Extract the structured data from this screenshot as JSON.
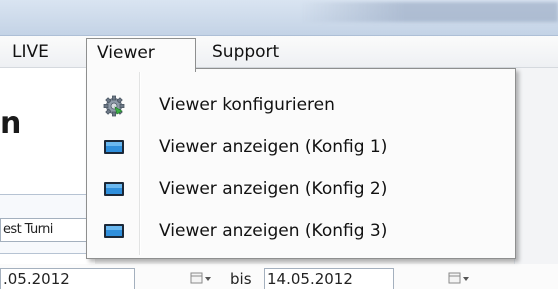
{
  "menubar": {
    "items": [
      {
        "label": "LIVE"
      },
      {
        "label": "Viewer"
      },
      {
        "label": "Support"
      }
    ]
  },
  "page": {
    "heading_fragment": "n",
    "field_fragment": "est Turni",
    "date_from": ".05.2012",
    "bis_label": "bis",
    "date_to": "14.05.2012"
  },
  "viewer_menu": {
    "items": [
      {
        "label": "Viewer konfigurieren",
        "icon": "gear-icon"
      },
      {
        "label": "Viewer anzeigen (Konfig 1)",
        "icon": "monitor-icon"
      },
      {
        "label": "Viewer anzeigen (Konfig 2)",
        "icon": "monitor-icon"
      },
      {
        "label": "Viewer anzeigen (Konfig 3)",
        "icon": "monitor-icon"
      }
    ]
  },
  "colors": {
    "menu_border": "#8e8f8f",
    "monitor_blue": "#2f8fdc"
  }
}
